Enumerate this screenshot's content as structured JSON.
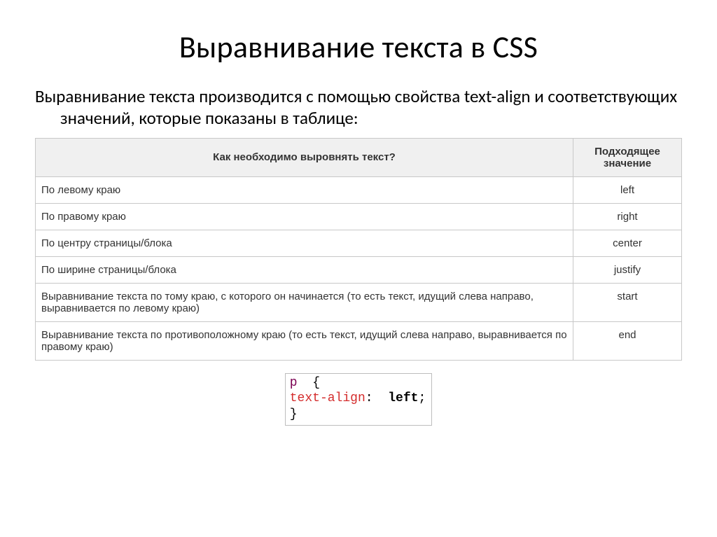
{
  "title": "Выравнивание текста в CSS",
  "body": "Выравнивание текста производится с помощью свойства text-align и соответствующих значений, которые показаны в таблице:",
  "table": {
    "header_desc": "Как необходимо выровнять текст?",
    "header_val": "Подходящее значение",
    "rows": [
      {
        "desc": "По левому краю",
        "val": "left"
      },
      {
        "desc": "По правому краю",
        "val": "right"
      },
      {
        "desc": "По центру страницы/блока",
        "val": "center"
      },
      {
        "desc": "По ширине страницы/блока",
        "val": "justify"
      },
      {
        "desc": "Выравнивание текста по тому краю, с которого он начинается (то есть текст, идущий слева направо, выравнивается по левому краю)",
        "val": "start"
      },
      {
        "desc": "Выравнивание текста по противоположному краю (то есть текст, идущий слева направо, выравнивается по правому краю)",
        "val": "end"
      }
    ]
  },
  "code": {
    "selector": "p",
    "brace_open": "{",
    "property": "text-align",
    "colon": ":",
    "value": "left",
    "semicolon": ";",
    "brace_close": "}"
  }
}
